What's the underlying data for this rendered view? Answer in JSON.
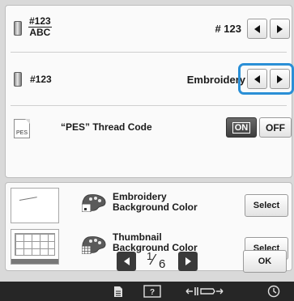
{
  "settings": {
    "thread_number_display": {
      "icon_top": "#123",
      "icon_bottom": "ABC",
      "value": "# 123",
      "icon": "spool-icon"
    },
    "thread_color_display": {
      "icon_label": "#123",
      "value": "Embroidery",
      "icon": "spool-icon"
    },
    "pes_thread_code": {
      "icon_label": "PES",
      "label": "“PES” Thread Code",
      "on_label": "ON",
      "off_label": "OFF",
      "selected": "ON"
    }
  },
  "background_colors": {
    "embroidery": {
      "label_line1": "Embroidery",
      "label_line2": "Background Color",
      "button": "Select",
      "icon": "palette-icon"
    },
    "thumbnail": {
      "label_line1": "Thumbnail",
      "label_line2": "Background Color",
      "button": "Select",
      "icon": "palette-icon"
    }
  },
  "pagination": {
    "current": "1",
    "total": "6"
  },
  "ok_label": "OK",
  "colors": {
    "highlight": "#2a8fd6",
    "toggle_on": "#4a4a4a",
    "bottom_bar": "#262626"
  },
  "bottom_bar_icons": [
    "document-icon",
    "help-icon",
    "needle-presser-icon",
    "clock-icon"
  ]
}
